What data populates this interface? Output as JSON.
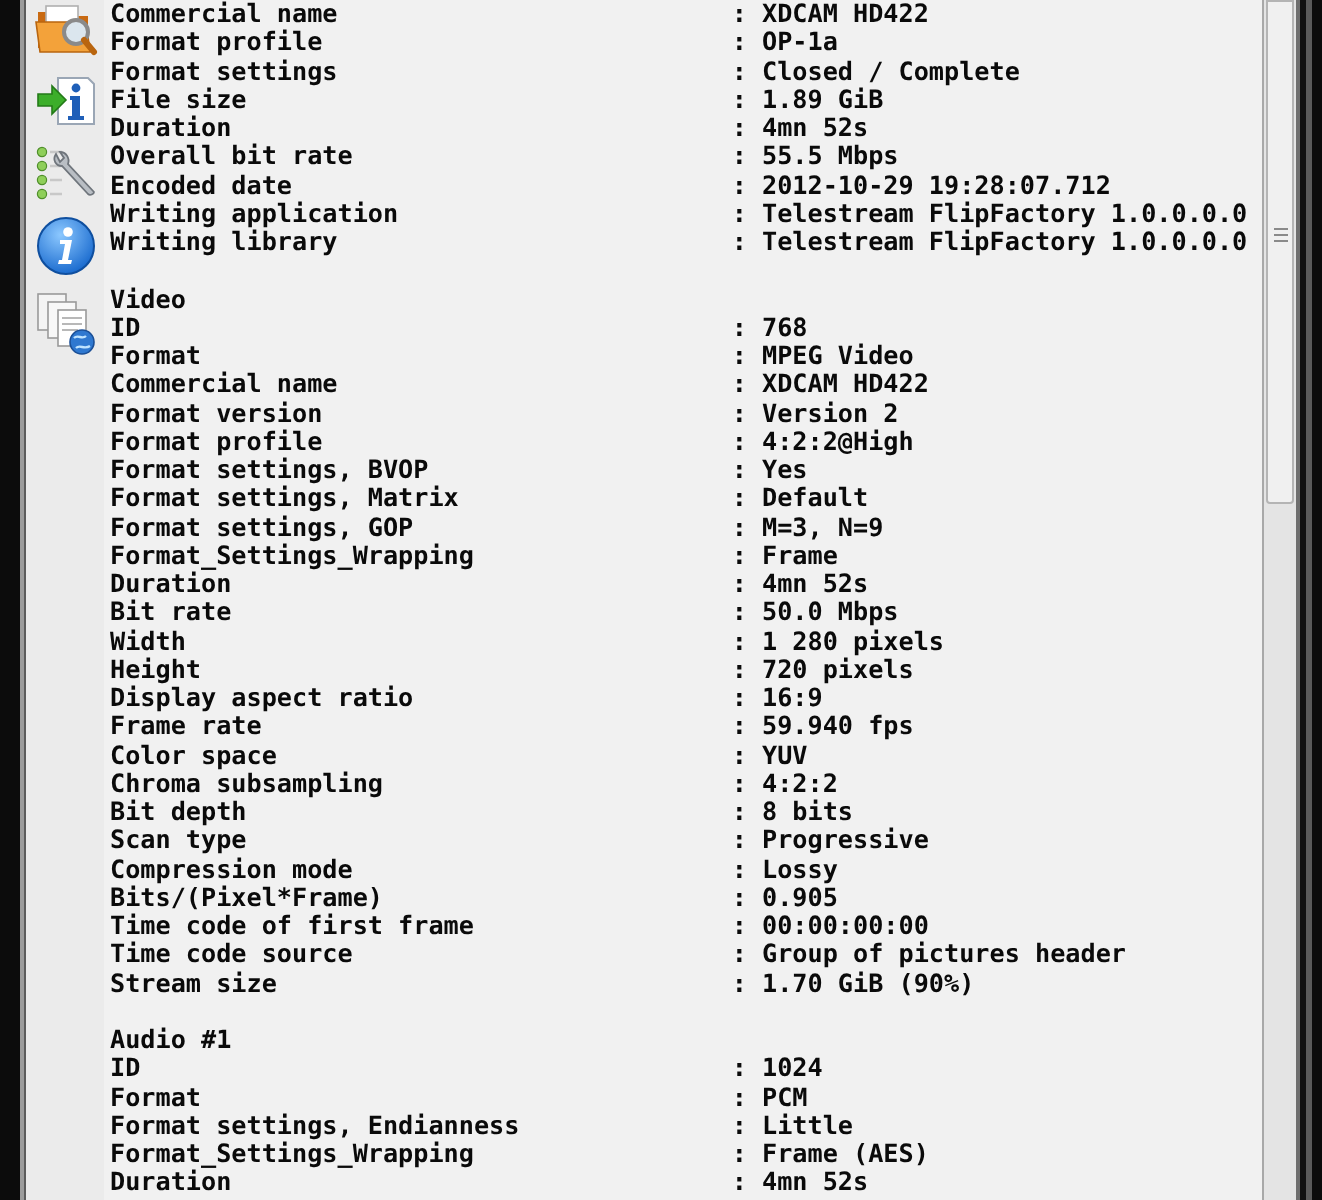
{
  "report": {
    "sections": [
      {
        "rows": [
          {
            "name": "Commercial name",
            "separator": ":",
            "value": "XDCAM HD422"
          },
          {
            "name": "Format profile",
            "separator": ":",
            "value": "OP-1a"
          },
          {
            "name": "Format settings",
            "separator": ":",
            "value": "Closed / Complete"
          },
          {
            "name": "File size",
            "separator": ":",
            "value": "1.89 GiB"
          },
          {
            "name": "Duration",
            "separator": ":",
            "value": "4mn 52s"
          },
          {
            "name": "Overall bit rate",
            "separator": ":",
            "value": "55.5 Mbps"
          },
          {
            "name": "Encoded date",
            "separator": ":",
            "value": "2012-10-29 19:28:07.712"
          },
          {
            "name": "Writing application",
            "separator": ":",
            "value": "Telestream FlipFactory 1.0.0.0.0"
          },
          {
            "name": "Writing library",
            "separator": ":",
            "value": "Telestream FlipFactory 1.0.0.0.0"
          }
        ]
      },
      {
        "title": "Video",
        "rows": [
          {
            "name": "ID",
            "separator": ":",
            "value": "768"
          },
          {
            "name": "Format",
            "separator": ":",
            "value": "MPEG Video"
          },
          {
            "name": "Commercial name",
            "separator": ":",
            "value": "XDCAM HD422"
          },
          {
            "name": "Format version",
            "separator": ":",
            "value": "Version 2"
          },
          {
            "name": "Format profile",
            "separator": ":",
            "value": "4:2:2@High"
          },
          {
            "name": "Format settings, BVOP",
            "separator": ":",
            "value": "Yes"
          },
          {
            "name": "Format settings, Matrix",
            "separator": ":",
            "value": "Default"
          },
          {
            "name": "Format settings, GOP",
            "separator": ":",
            "value": "M=3, N=9"
          },
          {
            "name": "Format_Settings_Wrapping",
            "separator": ":",
            "value": "Frame"
          },
          {
            "name": "Duration",
            "separator": ":",
            "value": "4mn 52s"
          },
          {
            "name": "Bit rate",
            "separator": ":",
            "value": "50.0 Mbps"
          },
          {
            "name": "Width",
            "separator": ":",
            "value": "1 280 pixels"
          },
          {
            "name": "Height",
            "separator": ":",
            "value": "720 pixels"
          },
          {
            "name": "Display aspect ratio",
            "separator": ":",
            "value": "16:9"
          },
          {
            "name": "Frame rate",
            "separator": ":",
            "value": "59.940 fps"
          },
          {
            "name": "Color space",
            "separator": ":",
            "value": "YUV"
          },
          {
            "name": "Chroma subsampling",
            "separator": ":",
            "value": "4:2:2"
          },
          {
            "name": "Bit depth",
            "separator": ":",
            "value": "8 bits"
          },
          {
            "name": "Scan type",
            "separator": ":",
            "value": "Progressive"
          },
          {
            "name": "Compression mode",
            "separator": ":",
            "value": "Lossy"
          },
          {
            "name": "Bits/(Pixel*Frame)",
            "separator": ":",
            "value": "0.905"
          },
          {
            "name": "Time code of first frame",
            "separator": ":",
            "value": "00:00:00:00"
          },
          {
            "name": "Time code source",
            "separator": ":",
            "value": "Group of pictures header"
          },
          {
            "name": "Stream size",
            "separator": ":",
            "value": "1.70 GiB (90%)"
          }
        ]
      },
      {
        "title": "Audio #1",
        "rows": [
          {
            "name": "ID",
            "separator": ":",
            "value": "1024"
          },
          {
            "name": "Format",
            "separator": ":",
            "value": "PCM"
          },
          {
            "name": "Format settings, Endianness",
            "separator": ":",
            "value": "Little"
          },
          {
            "name": "Format_Settings_Wrapping",
            "separator": ":",
            "value": "Frame (AES)"
          },
          {
            "name": "Duration",
            "separator": ":",
            "value": "4mn 52s"
          }
        ]
      }
    ]
  }
}
